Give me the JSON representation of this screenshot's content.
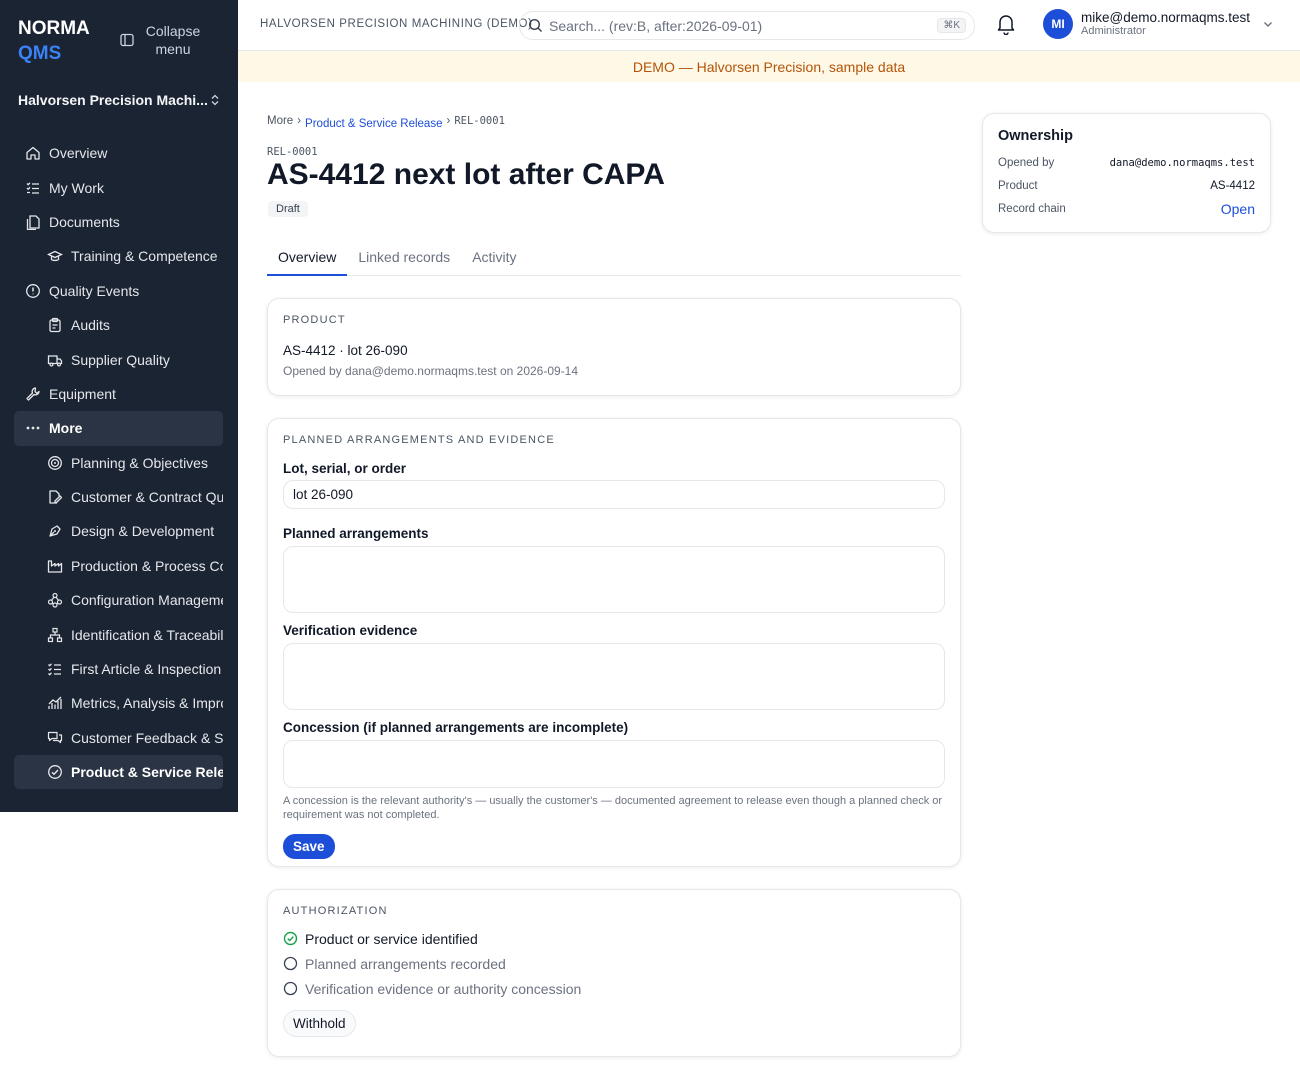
{
  "brand": {
    "line1": "NORMA",
    "line2": "QMS"
  },
  "sidebar": {
    "collapse_label": "Collapse menu",
    "org": "Halvorsen Precision Machi...",
    "items": [
      {
        "label": "Overview",
        "icon": "home-icon"
      },
      {
        "label": "My Work",
        "icon": "tasks-icon"
      },
      {
        "label": "Documents",
        "icon": "documents-icon"
      },
      {
        "label": "Training & Competence",
        "icon": "graduation-icon"
      },
      {
        "label": "Quality Events",
        "icon": "alert-circle-icon"
      },
      {
        "label": "Audits",
        "icon": "clipboard-icon"
      },
      {
        "label": "Supplier Quality",
        "icon": "truck-icon"
      },
      {
        "label": "Equipment",
        "icon": "wrench-icon"
      },
      {
        "label": "More",
        "icon": "dots-icon"
      },
      {
        "label": "Planning & Objectives",
        "icon": "target-icon"
      },
      {
        "label": "Customer & Contract Qua",
        "icon": "file-edit-icon"
      },
      {
        "label": "Design & Development",
        "icon": "pen-tool-icon"
      },
      {
        "label": "Production & Process Cor",
        "icon": "factory-icon"
      },
      {
        "label": "Configuration Manageme",
        "icon": "network-icon"
      },
      {
        "label": "Identification & Traceabilit",
        "icon": "hierarchy-icon"
      },
      {
        "label": "First Article & Inspection F",
        "icon": "checklist-icon"
      },
      {
        "label": "Metrics, Analysis & Impro",
        "icon": "chart-icon"
      },
      {
        "label": "Customer Feedback & Sat",
        "icon": "messages-icon"
      },
      {
        "label": "Product & Service Releas",
        "icon": "check-circle-icon"
      }
    ]
  },
  "topbar": {
    "company": "HALVORSEN PRECISION MACHINING (DEMO)",
    "search_placeholder": "Search... (rev:B, after:2026-09-01)",
    "shortcut": "⌘K",
    "user_initials": "MI",
    "user_email": "mike@demo.normaqms.test",
    "user_role": "Administrator"
  },
  "banner": "DEMO — Halvorsen Precision, sample data",
  "breadcrumb": {
    "root": "More",
    "section": "Product & Service Release",
    "current": "REL-0001"
  },
  "record": {
    "id": "REL-0001",
    "title": "AS-4412 next lot after CAPA",
    "status": "Draft"
  },
  "tabs": [
    "Overview",
    "Linked records",
    "Activity"
  ],
  "product_card": {
    "heading": "PRODUCT",
    "product_line": "AS-4412 · lot 26-090",
    "opened_line": "Opened by dana@demo.normaqms.test on 2026-09-14"
  },
  "planned_card": {
    "heading": "PLANNED ARRANGEMENTS AND EVIDENCE",
    "lot_label": "Lot, serial, or order",
    "lot_value": "lot 26-090",
    "arrangements_label": "Planned arrangements",
    "evidence_label": "Verification evidence",
    "concession_label": "Concession (if planned arrangements are incomplete)",
    "concession_help": "A concession is the relevant authority's — usually the customer's — documented agreement to release even though a planned check or requirement was not completed.",
    "save_label": "Save"
  },
  "authorization_card": {
    "heading": "AUTHORIZATION",
    "checks": [
      {
        "label": "Product or service identified",
        "done": true
      },
      {
        "label": "Planned arrangements recorded",
        "done": false
      },
      {
        "label": "Verification evidence or authority concession",
        "done": false
      }
    ],
    "withhold_label": "Withhold"
  },
  "ownership": {
    "title": "Ownership",
    "opened_by_label": "Opened by",
    "opened_by": "dana@demo.normaqms.test",
    "product_label": "Product",
    "product": "AS-4412",
    "chain_label": "Record chain",
    "chain_link": "Open"
  },
  "colors": {
    "sidebar": "#1b2433",
    "accent": "#1d4ed8",
    "banner_bg": "#fef9e7",
    "banner_text": "#b45309",
    "success": "#16a34a"
  }
}
